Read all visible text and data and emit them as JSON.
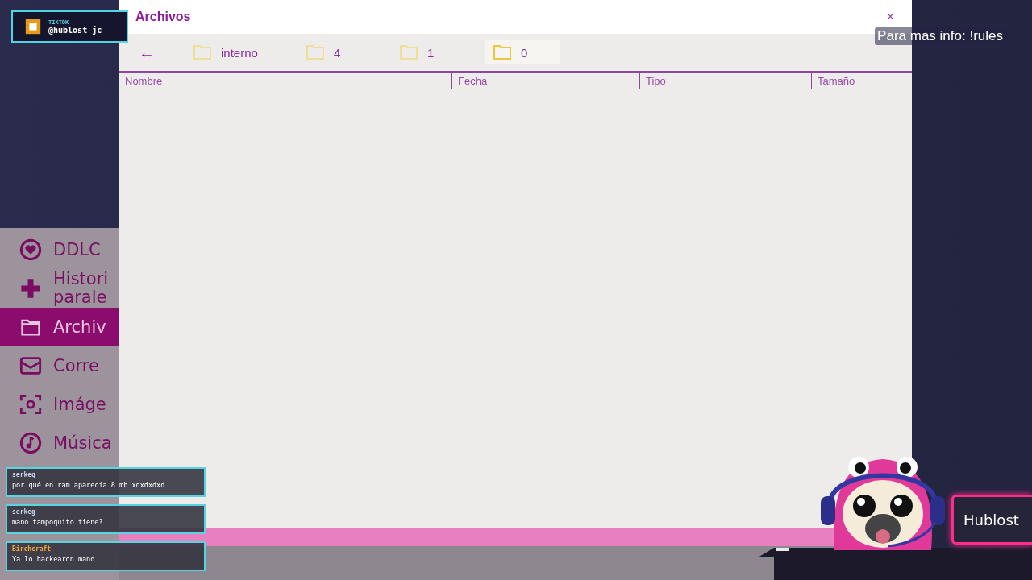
{
  "stream_overlay": {
    "tiktok_badge": {
      "label": "TIKTOK",
      "handle": "@hublost_jc"
    },
    "info_text": "Para mas info: !rules",
    "nameplate": "Hublost"
  },
  "sidebar": {
    "items": [
      {
        "label": "DDLC",
        "kind": "heart",
        "selected": false
      },
      {
        "label": "Histori parale",
        "kind": "plus",
        "selected": false
      },
      {
        "label": "Archiv",
        "kind": "folder",
        "selected": true
      },
      {
        "label": "Corre",
        "kind": "mail",
        "selected": false
      },
      {
        "label": "Imáge",
        "kind": "camera",
        "selected": false
      },
      {
        "label": "Música",
        "kind": "music",
        "selected": false
      }
    ]
  },
  "window": {
    "title": "Archivos",
    "close": "×",
    "back": "←",
    "folders": [
      {
        "label": "interno",
        "selected": false
      },
      {
        "label": "4",
        "selected": false
      },
      {
        "label": "1",
        "selected": false
      },
      {
        "label": "0",
        "selected": true
      }
    ],
    "columns": [
      "Nombre",
      "Fecha",
      "Tipo",
      "Tamaño"
    ]
  },
  "chat": [
    {
      "user": "serkeg",
      "color": "#c9d6f2",
      "message": "por qué en ram aparecía 8 mb xdxdxdxd"
    },
    {
      "user": "serkeg",
      "color": "#c9d6f2",
      "message": "mano tampoquito tiene?"
    },
    {
      "user": "Birchcraft",
      "color": "#f2a83a",
      "message": "Ya lo hackearon mano"
    }
  ]
}
